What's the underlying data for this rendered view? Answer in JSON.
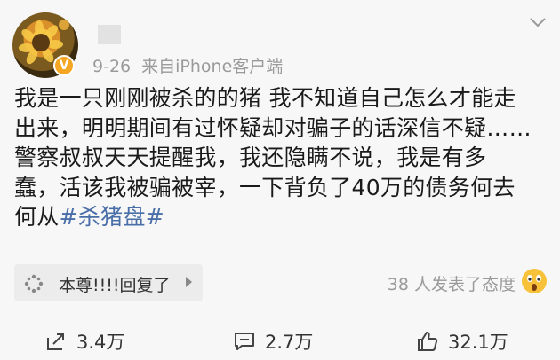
{
  "post": {
    "date": "9-26",
    "source": "来自iPhone客户端",
    "verified_badge": "V",
    "text_lines": [
      "我是一只刚刚被杀的的猪 我不知道自己怎么才能走",
      "出来，明明期间有过怀疑却对骗子的话深信不疑……",
      "警察叔叔天天提醒我，我还隐瞒不说，我是有多",
      "蠢，活该我被骗被宰，一下背负了40万的债务何去"
    ],
    "last_line_prefix": "何从",
    "hashtag": "#杀猪盘#"
  },
  "comment_chip": {
    "text": "本尊!!!!回复了"
  },
  "reactions": {
    "text": "38 人发表了态度"
  },
  "footer": {
    "share_count": "3.4万",
    "comment_count": "2.7万",
    "like_count": "32.1万"
  },
  "colors": {
    "hashtag": "#4a6fa8",
    "verified": "#f5a623",
    "meta_text": "#9a9a9a"
  },
  "icons": {
    "share": "share-icon",
    "comment": "comment-icon",
    "like": "thumbs-up-icon",
    "more": "chevron-down-icon",
    "reaction": "surprised-face-icon"
  }
}
